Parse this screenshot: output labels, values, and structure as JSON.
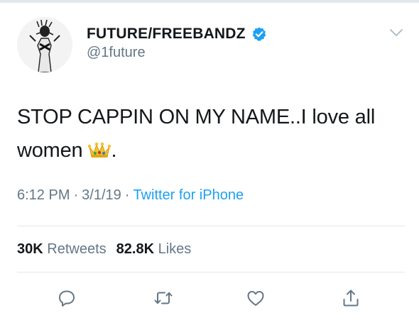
{
  "tweet": {
    "display_name": "FUTURE/FREEBANDZ",
    "handle": "@1future",
    "verified_icon": "verified-badge-icon",
    "text_before_emoji": "STOP CAPPIN ON MY NAME..I love all women",
    "emoji": "crown-emoji",
    "text_after_emoji": ".",
    "time": "6:12 PM",
    "date": "3/1/19",
    "source": "Twitter for iPhone",
    "separator": "·",
    "retweets_count": "30K",
    "retweets_label": "Retweets",
    "likes_count": "82.8K",
    "likes_label": "Likes"
  },
  "actions": {
    "reply_icon": "reply-icon",
    "retweet_icon": "retweet-icon",
    "like_icon": "heart-icon",
    "share_icon": "share-icon"
  },
  "colors": {
    "accent": "#1da1f2",
    "secondary_text": "#657786",
    "primary_text": "#14171a",
    "divider": "#e1e8ed"
  }
}
